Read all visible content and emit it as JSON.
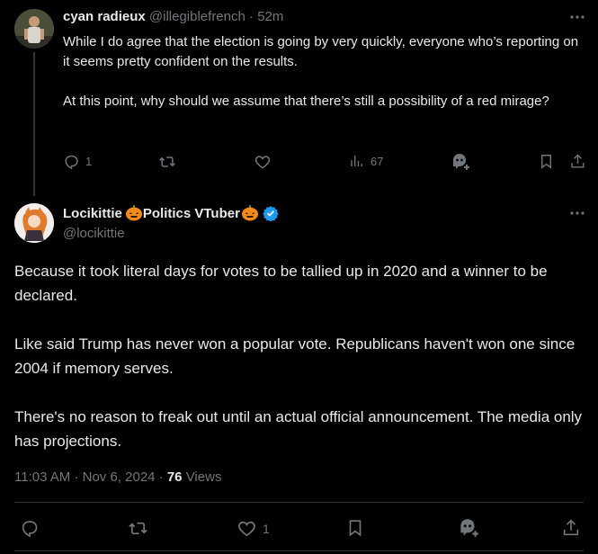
{
  "reply": {
    "display_name": "cyan radieux",
    "handle": "@illegiblefrench",
    "separator": "·",
    "time": "52m",
    "paragraphs": [
      "While I do agree that the election is going by very quickly, everyone who’s reporting on it seems pretty confident on the results.",
      "At this point, why should we assume that there’s still a possibility of a red mirage?"
    ],
    "replies_count": "1",
    "views_count": "67"
  },
  "main": {
    "display_name": "Locikittie",
    "name_suffix": "Politics VTuber",
    "handle": "@locikittie",
    "paragraphs": [
      "Because it took literal days for votes to be tallied up in 2020 and a winner to be declared.",
      "Like said Trump has never won a popular vote. Republicans haven't won one since 2004 if memory serves.",
      "There's no reason to freak out until an actual official announcement. The media only has projections."
    ],
    "time": "11:03 AM",
    "dot1": "·",
    "date": "Nov 6, 2024",
    "dot2": "·",
    "views": "76",
    "views_label": "Views",
    "likes_count": "1"
  },
  "icons": {
    "more": "more-horizontal-icon",
    "reply": "reply-icon",
    "retweet": "retweet-icon",
    "like": "heart-icon",
    "views": "analytics-icon",
    "grok": "grok-icon",
    "bookmark": "bookmark-icon",
    "share": "share-icon",
    "verified": "verified-badge-icon"
  },
  "colors": {
    "background": "#000000",
    "text": "#e7e9ea",
    "muted": "#71767b",
    "verified": "#1d9bf0",
    "pumpkin": "#f28b1c"
  }
}
